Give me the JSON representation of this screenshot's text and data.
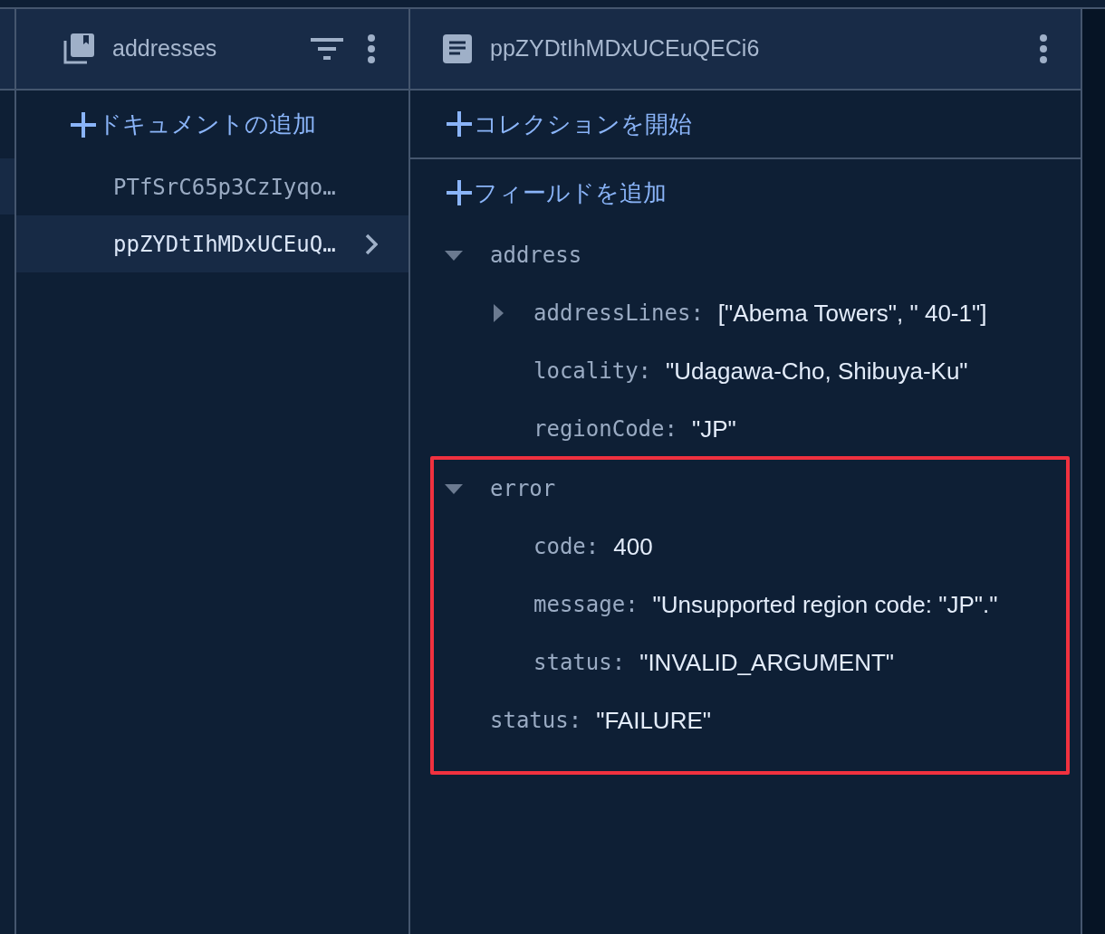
{
  "collection_panel": {
    "title": "addresses",
    "add_label": "ドキュメントの追加",
    "documents": [
      {
        "id": "PTfSrC65p3CzIyqo…",
        "selected": false
      },
      {
        "id": "ppZYDtIhMDxUCEuQ…",
        "selected": true
      }
    ]
  },
  "document_panel": {
    "title": "ppZYDtIhMDxUCEuQECi6",
    "add_collection_label": "コレクションを開始",
    "add_field_label": "フィールドを追加",
    "fields": [
      {
        "key": "address",
        "expanded": true,
        "children": [
          {
            "key": "addressLines:",
            "value": "[\"Abema Towers\", \" 40-1\"]",
            "expanded": false
          },
          {
            "key": "locality:",
            "value": "\"Udagawa-Cho, Shibuya-Ku\""
          },
          {
            "key": "regionCode:",
            "value": "\"JP\""
          }
        ]
      }
    ],
    "highlighted_fields": [
      {
        "key": "error",
        "expanded": true,
        "children": [
          {
            "key": "code:",
            "value": "400"
          },
          {
            "key": "message:",
            "value": "\"Unsupported region code: \"JP\".\""
          },
          {
            "key": "status:",
            "value": "\"INVALID_ARGUMENT\""
          }
        ]
      },
      {
        "key": "status:",
        "value": "\"FAILURE\""
      }
    ]
  }
}
